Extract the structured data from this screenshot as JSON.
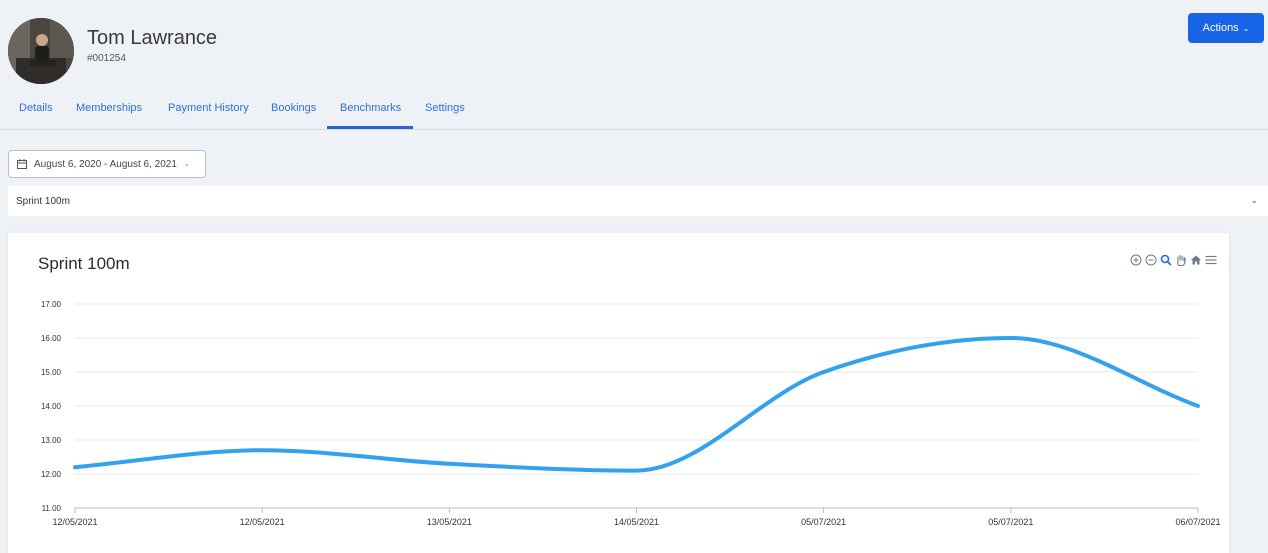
{
  "profile": {
    "name": "Tom Lawrance",
    "member_id": "#001254"
  },
  "actions": {
    "label": "Actions"
  },
  "tabs": [
    {
      "label": "Details",
      "active": false
    },
    {
      "label": "Memberships",
      "active": false
    },
    {
      "label": "Payment History",
      "active": false
    },
    {
      "label": "Bookings",
      "active": false
    },
    {
      "label": "Benchmarks",
      "active": true
    },
    {
      "label": "Settings",
      "active": false
    }
  ],
  "date_range": {
    "value": "August 6, 2020 - August 6, 2021"
  },
  "benchmark_select": {
    "value": "Sprint 100m"
  },
  "card": {
    "title": "Sprint 100m"
  },
  "toolbar": {
    "icons": [
      "zoom-in-icon",
      "zoom-out-icon",
      "zoom-select-icon",
      "pan-icon",
      "home-reset-icon",
      "menu-icon"
    ]
  },
  "colors": {
    "accent": "#1764e6",
    "tab_text": "#2e6fe0",
    "line": "#33a1ec"
  },
  "chart_data": {
    "type": "line",
    "title": "Sprint 100m",
    "categories": [
      "12/05/2021",
      "12/05/2021",
      "13/05/2021",
      "14/05/2021",
      "05/07/2021",
      "05/07/2021",
      "06/07/2021"
    ],
    "series": [
      {
        "values": [
          12.2,
          12.7,
          12.3,
          12.1,
          15.0,
          16.0,
          14.0
        ]
      }
    ],
    "y_ticks": [
      "11.00",
      "12.00",
      "13.00",
      "14.00",
      "15.00",
      "16.00",
      "17.00"
    ],
    "ylim": [
      11,
      17
    ],
    "grid": true,
    "smooth": true
  }
}
